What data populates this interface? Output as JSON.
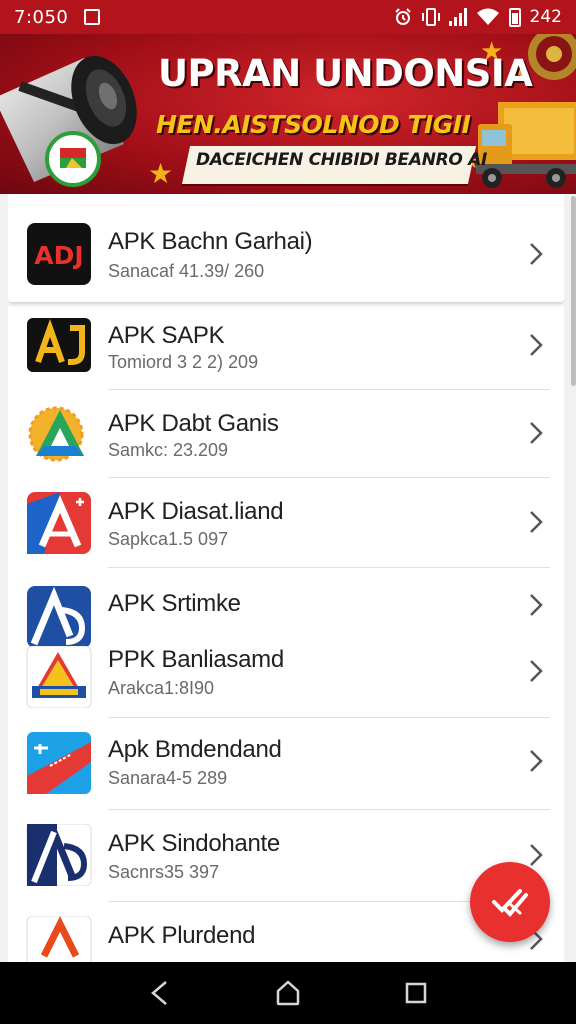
{
  "status_bar": {
    "time": "7:050",
    "battery_level": "242",
    "icons": [
      "image-icon",
      "alarm-icon",
      "vibrate-icon",
      "signal-icon",
      "wifi-icon",
      "battery-icon"
    ]
  },
  "banner": {
    "title": "UPRAN UNDONSIA",
    "subtitle": "HEN.AISTSOLNOD TIGII",
    "tagline": "DACEICHEN CHIBIDI BEANRO AI"
  },
  "apps": [
    {
      "title": "APK Bachn Garhai)",
      "subtitle": "Sanacaf 41.39/ 260",
      "icon": "ads-app-icon",
      "selected": true
    },
    {
      "title": "APK SAPK",
      "subtitle": "Tomiord 3 2 2) 209",
      "icon": "aj-app-icon"
    },
    {
      "title": "APK Dabt Ganis",
      "subtitle": "Samkc: 23.209",
      "icon": "green-a-app-icon"
    },
    {
      "title": "APK Diasat.liand",
      "subtitle": "Sapkca1.5 097",
      "icon": "red-a-app-icon"
    },
    {
      "title": "APK Srtimke",
      "subtitle": "",
      "icon": "blue-ab-app-icon"
    },
    {
      "title": "PPK Banliasamd",
      "subtitle": "Arakca1:8I90",
      "icon": "yellow-a-app-icon"
    },
    {
      "title": "Apk Bmdendand",
      "subtitle": "Sanara4-5 289",
      "icon": "ticket-app-icon"
    },
    {
      "title": "APK Sindohante",
      "subtitle": "Sacnrs35 397",
      "icon": "navy-ab-app-icon"
    },
    {
      "title": "APK Plurdend",
      "subtitle": "",
      "icon": "orange-a-app-icon"
    }
  ],
  "colors": {
    "status_bar": "#b3141c",
    "banner": "#a30f18",
    "fab": "#e8302f",
    "text": "#212121"
  },
  "fab": {
    "icon": "double-check-icon"
  },
  "nav": {
    "icons": [
      "back-icon",
      "home-icon",
      "recents-icon"
    ]
  }
}
